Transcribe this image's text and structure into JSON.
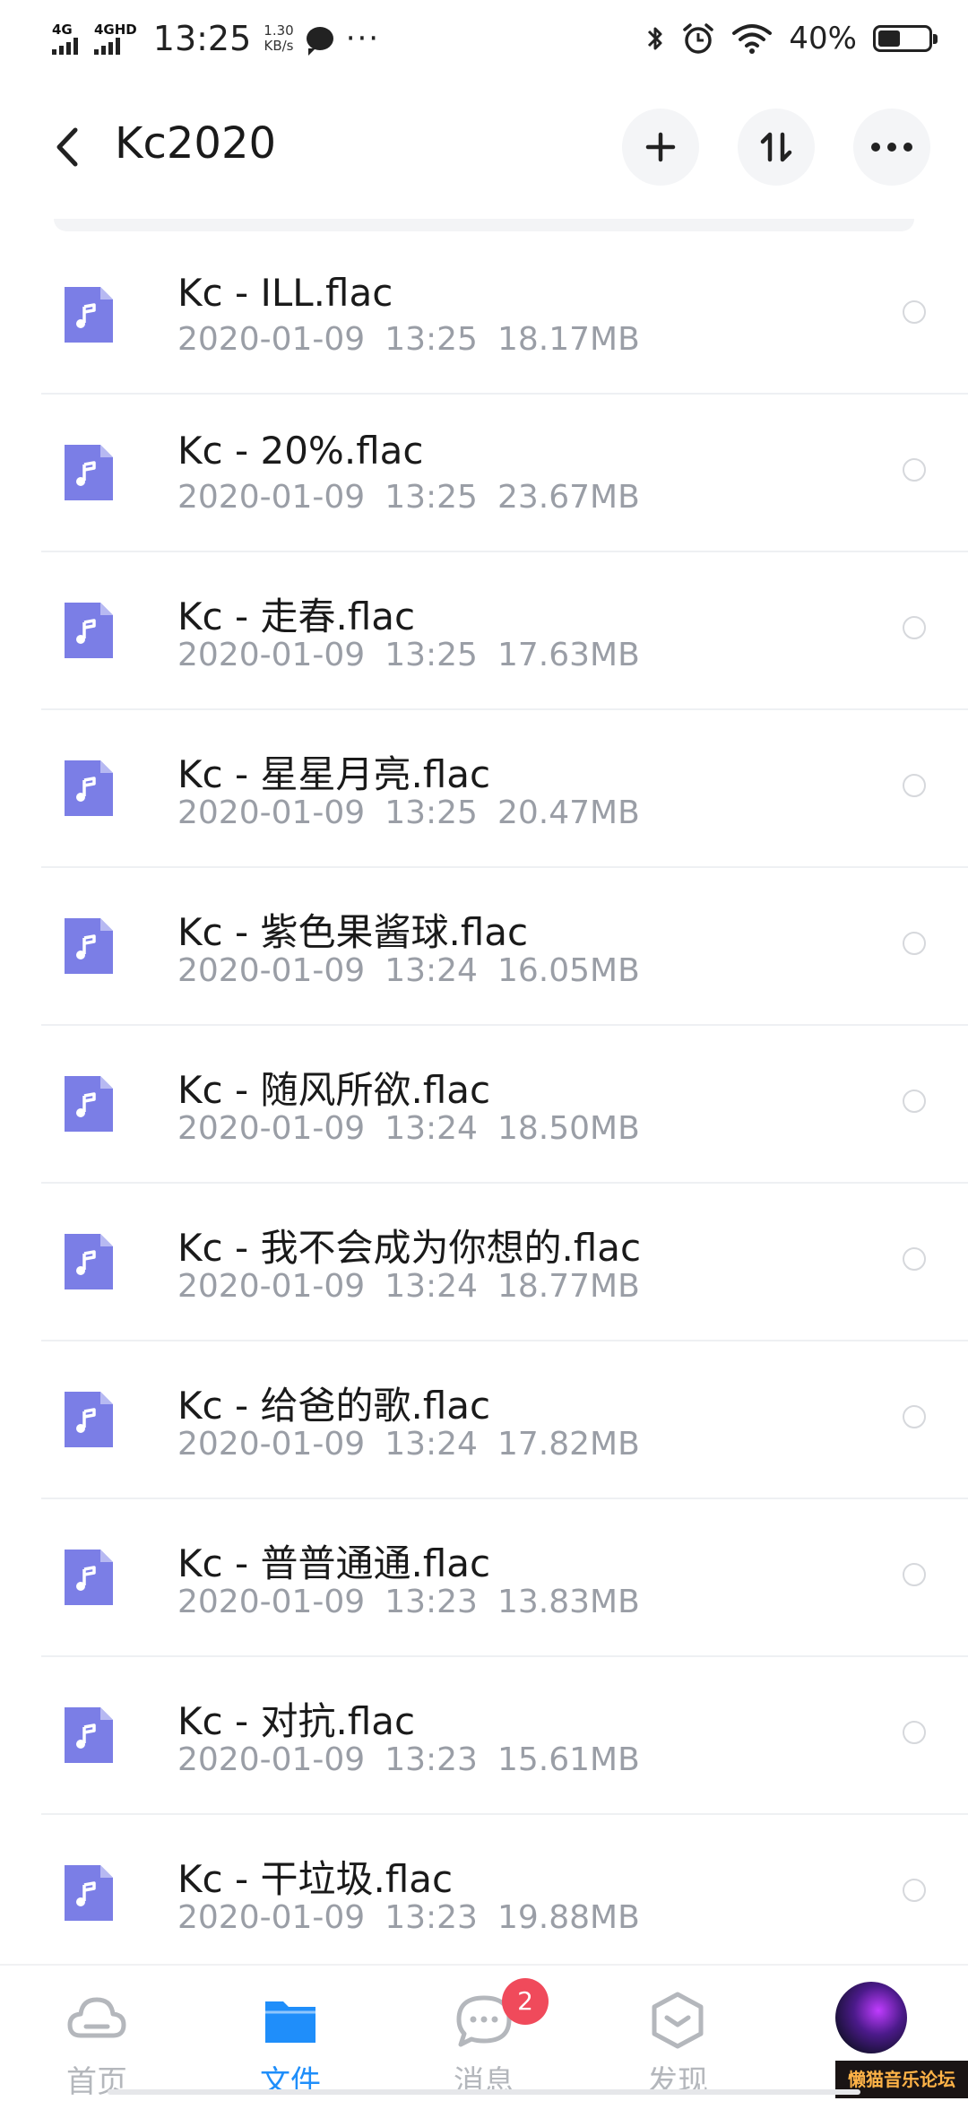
{
  "status_bar": {
    "signal1": "4G",
    "signal2": "4GHD",
    "time": "13:25",
    "net_speed_value": "1.30",
    "net_speed_unit": "KB/s",
    "battery_percent": "40%",
    "icons": [
      "chat-bubble-icon",
      "more-dots-icon",
      "bluetooth-icon",
      "alarm-icon",
      "wifi-icon",
      "battery-icon"
    ]
  },
  "header": {
    "title": "Kc2020",
    "icons": [
      "back-arrow-icon",
      "plus-icon",
      "sort-icon",
      "more-icon"
    ]
  },
  "files": [
    {
      "name": "Kc - ILL.flac",
      "date": "2020-01-09",
      "time": "13:25",
      "size": "18.17MB"
    },
    {
      "name": "Kc - 20%.flac",
      "date": "2020-01-09",
      "time": "13:25",
      "size": "23.67MB"
    },
    {
      "name": "Kc - 走春.flac",
      "date": "2020-01-09",
      "time": "13:25",
      "size": "17.63MB"
    },
    {
      "name": "Kc - 星星月亮.flac",
      "date": "2020-01-09",
      "time": "13:25",
      "size": "20.47MB"
    },
    {
      "name": "Kc - 紫色果酱球.flac",
      "date": "2020-01-09",
      "time": "13:24",
      "size": "16.05MB"
    },
    {
      "name": "Kc - 随风所欲.flac",
      "date": "2020-01-09",
      "time": "13:24",
      "size": "18.50MB"
    },
    {
      "name": "Kc - 我不会成为你想的.flac",
      "date": "2020-01-09",
      "time": "13:24",
      "size": "18.77MB"
    },
    {
      "name": "Kc - 给爸的歌.flac",
      "date": "2020-01-09",
      "time": "13:24",
      "size": "17.82MB"
    },
    {
      "name": "Kc - 普普通通.flac",
      "date": "2020-01-09",
      "time": "13:23",
      "size": "13.83MB"
    },
    {
      "name": "Kc - 对抗.flac",
      "date": "2020-01-09",
      "time": "13:23",
      "size": "15.61MB"
    },
    {
      "name": "Kc - 干垃圾.flac",
      "date": "2020-01-09",
      "time": "13:23",
      "size": "19.88MB"
    }
  ],
  "file_icon": "music-file-icon",
  "colors": {
    "file_icon": "#7b7ee6",
    "active_tab": "#1f8efa",
    "inactive_tab": "#b4b7bc",
    "badge": "#f04a5b",
    "meta_text": "#9a9ea6"
  },
  "tabbar": {
    "tabs": [
      {
        "label": "首页",
        "icon": "cloud-icon"
      },
      {
        "label": "文件",
        "icon": "folder-icon",
        "active": true
      },
      {
        "label": "消息",
        "icon": "message-icon",
        "badge": "2"
      },
      {
        "label": "发现",
        "icon": "discover-icon"
      },
      {
        "label": "",
        "icon": "avatar"
      }
    ]
  },
  "watermark": "懒猫音乐论坛"
}
